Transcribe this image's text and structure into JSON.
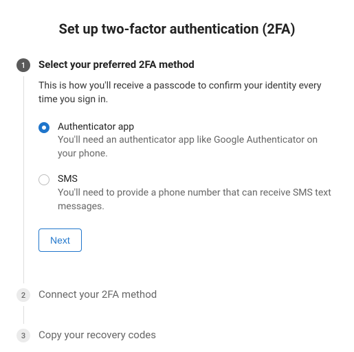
{
  "title": "Set up two-factor authentication (2FA)",
  "steps": [
    {
      "num": "1",
      "title": "Select your preferred 2FA method"
    },
    {
      "num": "2",
      "title": "Connect your 2FA method"
    },
    {
      "num": "3",
      "title": "Copy your recovery codes"
    }
  ],
  "step1": {
    "description": "This is how you'll receive a passcode to confirm your identity every time you sign in.",
    "options": [
      {
        "label": "Authenticator app",
        "sub": "You'll need an authenticator app like Google Authenticator on your phone.",
        "selected": true
      },
      {
        "label": "SMS",
        "sub": "You'll need to provide a phone number that can receive SMS text messages.",
        "selected": false
      }
    ],
    "next": "Next"
  }
}
